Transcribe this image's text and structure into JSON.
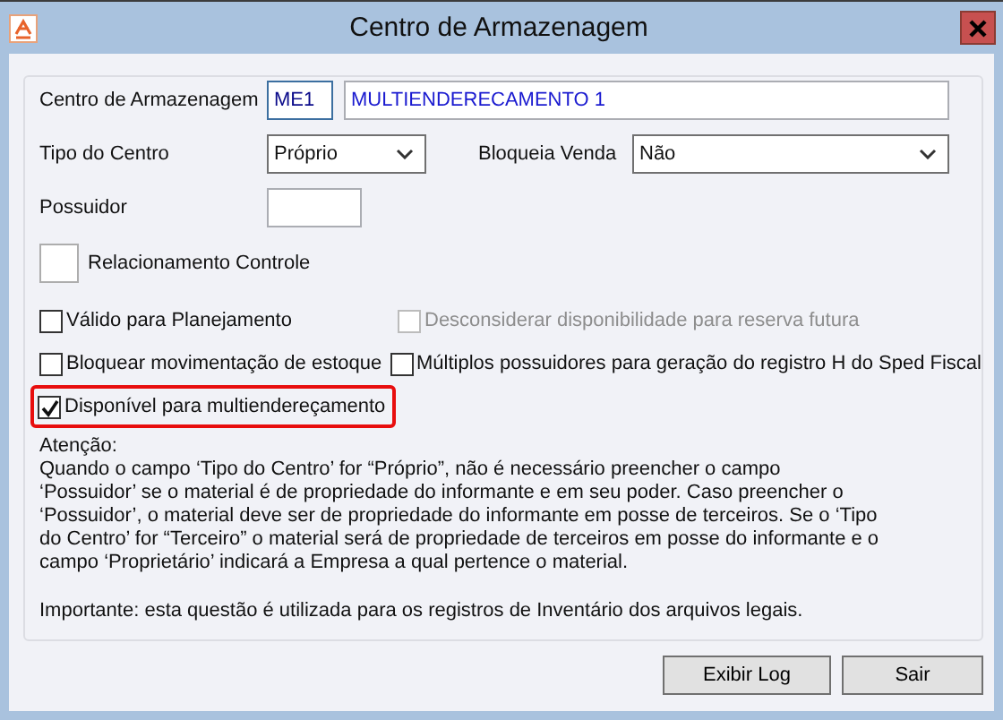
{
  "window": {
    "title": "Centro de Armazenagem"
  },
  "form": {
    "centro": {
      "label": "Centro de Armazenagem",
      "code": "ME1",
      "name": "MULTIENDERECAMENTO 1"
    },
    "tipo": {
      "label": "Tipo do Centro",
      "value": "Próprio"
    },
    "bloqueia": {
      "label": "Bloqueia Venda",
      "value": "Não"
    },
    "possuidor": {
      "label": "Possuidor"
    },
    "relacionamento": {
      "label": "Relacionamento Controle"
    },
    "checkbox_rows": [
      [
        {
          "label": "Válido para Planejamento",
          "checked": false,
          "disabled": false,
          "highlighted": false
        },
        {
          "label": "Desconsiderar disponibilidade para reserva futura",
          "checked": false,
          "disabled": true,
          "highlighted": false
        }
      ],
      [
        {
          "label": "Bloquear movimentação de estoque",
          "checked": false,
          "disabled": false,
          "highlighted": false
        },
        {
          "label": "Múltiplos possuidores para geração do registro H do Sped Fiscal",
          "checked": false,
          "disabled": false,
          "highlighted": false
        }
      ],
      [
        {
          "label": "Disponível para multiendereçamento",
          "checked": true,
          "disabled": false,
          "highlighted": true
        }
      ]
    ],
    "notice": {
      "heading": "Atenção:",
      "body": "Quando o campo ‘Tipo do Centro’ for “Próprio”, não é necessário preencher o campo ‘Possuidor’ se o material é de propriedade do informante e em seu poder. Caso preencher o ‘Possuidor’, o material deve ser de propriedade do informante em posse de terceiros. Se o ‘Tipo do Centro’ for “Terceiro” o material será de propriedade de terceiros em posse do informante e o campo ‘Proprietário’ indicará a Empresa a qual pertence o material.",
      "important": "Importante: esta questão é utilizada para os registros de Inventário dos arquivos legais."
    }
  },
  "buttons": [
    "Exibir Log",
    "Sair"
  ]
}
